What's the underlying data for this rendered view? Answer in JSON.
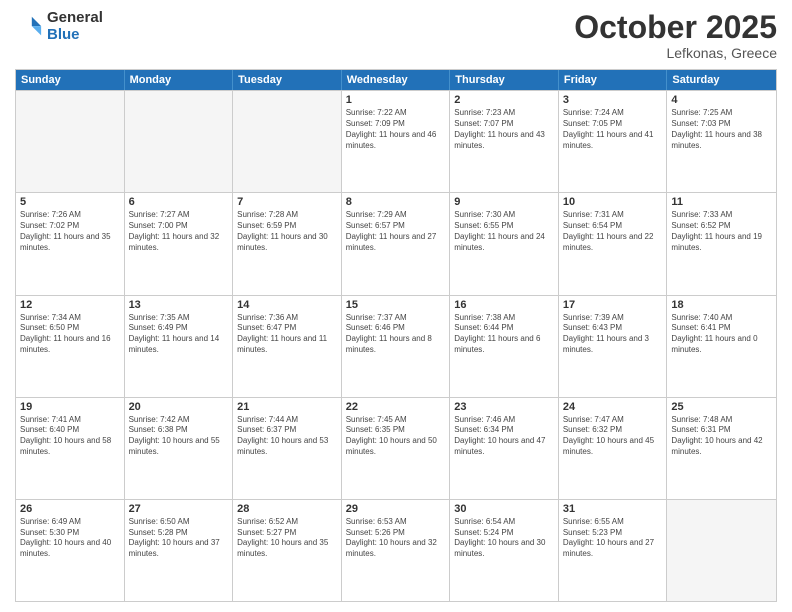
{
  "logo": {
    "general": "General",
    "blue": "Blue"
  },
  "title": {
    "month_year": "October 2025",
    "location": "Lefkonas, Greece"
  },
  "days_of_week": [
    "Sunday",
    "Monday",
    "Tuesday",
    "Wednesday",
    "Thursday",
    "Friday",
    "Saturday"
  ],
  "weeks": [
    [
      {
        "date": "",
        "empty": true
      },
      {
        "date": "",
        "empty": true
      },
      {
        "date": "",
        "empty": true
      },
      {
        "date": "1",
        "sunrise": "7:22 AM",
        "sunset": "7:09 PM",
        "daylight": "11 hours and 46 minutes."
      },
      {
        "date": "2",
        "sunrise": "7:23 AM",
        "sunset": "7:07 PM",
        "daylight": "11 hours and 43 minutes."
      },
      {
        "date": "3",
        "sunrise": "7:24 AM",
        "sunset": "7:05 PM",
        "daylight": "11 hours and 41 minutes."
      },
      {
        "date": "4",
        "sunrise": "7:25 AM",
        "sunset": "7:03 PM",
        "daylight": "11 hours and 38 minutes."
      }
    ],
    [
      {
        "date": "5",
        "sunrise": "7:26 AM",
        "sunset": "7:02 PM",
        "daylight": "11 hours and 35 minutes."
      },
      {
        "date": "6",
        "sunrise": "7:27 AM",
        "sunset": "7:00 PM",
        "daylight": "11 hours and 32 minutes."
      },
      {
        "date": "7",
        "sunrise": "7:28 AM",
        "sunset": "6:59 PM",
        "daylight": "11 hours and 30 minutes."
      },
      {
        "date": "8",
        "sunrise": "7:29 AM",
        "sunset": "6:57 PM",
        "daylight": "11 hours and 27 minutes."
      },
      {
        "date": "9",
        "sunrise": "7:30 AM",
        "sunset": "6:55 PM",
        "daylight": "11 hours and 24 minutes."
      },
      {
        "date": "10",
        "sunrise": "7:31 AM",
        "sunset": "6:54 PM",
        "daylight": "11 hours and 22 minutes."
      },
      {
        "date": "11",
        "sunrise": "7:33 AM",
        "sunset": "6:52 PM",
        "daylight": "11 hours and 19 minutes."
      }
    ],
    [
      {
        "date": "12",
        "sunrise": "7:34 AM",
        "sunset": "6:50 PM",
        "daylight": "11 hours and 16 minutes."
      },
      {
        "date": "13",
        "sunrise": "7:35 AM",
        "sunset": "6:49 PM",
        "daylight": "11 hours and 14 minutes."
      },
      {
        "date": "14",
        "sunrise": "7:36 AM",
        "sunset": "6:47 PM",
        "daylight": "11 hours and 11 minutes."
      },
      {
        "date": "15",
        "sunrise": "7:37 AM",
        "sunset": "6:46 PM",
        "daylight": "11 hours and 8 minutes."
      },
      {
        "date": "16",
        "sunrise": "7:38 AM",
        "sunset": "6:44 PM",
        "daylight": "11 hours and 6 minutes."
      },
      {
        "date": "17",
        "sunrise": "7:39 AM",
        "sunset": "6:43 PM",
        "daylight": "11 hours and 3 minutes."
      },
      {
        "date": "18",
        "sunrise": "7:40 AM",
        "sunset": "6:41 PM",
        "daylight": "11 hours and 0 minutes."
      }
    ],
    [
      {
        "date": "19",
        "sunrise": "7:41 AM",
        "sunset": "6:40 PM",
        "daylight": "10 hours and 58 minutes."
      },
      {
        "date": "20",
        "sunrise": "7:42 AM",
        "sunset": "6:38 PM",
        "daylight": "10 hours and 55 minutes."
      },
      {
        "date": "21",
        "sunrise": "7:44 AM",
        "sunset": "6:37 PM",
        "daylight": "10 hours and 53 minutes."
      },
      {
        "date": "22",
        "sunrise": "7:45 AM",
        "sunset": "6:35 PM",
        "daylight": "10 hours and 50 minutes."
      },
      {
        "date": "23",
        "sunrise": "7:46 AM",
        "sunset": "6:34 PM",
        "daylight": "10 hours and 47 minutes."
      },
      {
        "date": "24",
        "sunrise": "7:47 AM",
        "sunset": "6:32 PM",
        "daylight": "10 hours and 45 minutes."
      },
      {
        "date": "25",
        "sunrise": "7:48 AM",
        "sunset": "6:31 PM",
        "daylight": "10 hours and 42 minutes."
      }
    ],
    [
      {
        "date": "26",
        "sunrise": "6:49 AM",
        "sunset": "5:30 PM",
        "daylight": "10 hours and 40 minutes."
      },
      {
        "date": "27",
        "sunrise": "6:50 AM",
        "sunset": "5:28 PM",
        "daylight": "10 hours and 37 minutes."
      },
      {
        "date": "28",
        "sunrise": "6:52 AM",
        "sunset": "5:27 PM",
        "daylight": "10 hours and 35 minutes."
      },
      {
        "date": "29",
        "sunrise": "6:53 AM",
        "sunset": "5:26 PM",
        "daylight": "10 hours and 32 minutes."
      },
      {
        "date": "30",
        "sunrise": "6:54 AM",
        "sunset": "5:24 PM",
        "daylight": "10 hours and 30 minutes."
      },
      {
        "date": "31",
        "sunrise": "6:55 AM",
        "sunset": "5:23 PM",
        "daylight": "10 hours and 27 minutes."
      },
      {
        "date": "",
        "empty": true
      }
    ]
  ]
}
